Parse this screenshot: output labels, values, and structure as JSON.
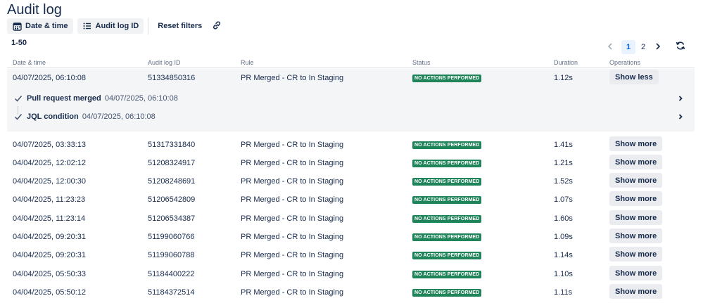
{
  "page": {
    "title": "Audit log"
  },
  "toolbar": {
    "date_time_label": "Date & time",
    "audit_id_label": "Audit log ID",
    "reset_label": "Reset filters"
  },
  "pagination": {
    "range": "1-50",
    "pages": [
      "1",
      "2"
    ],
    "current": "1"
  },
  "columns": [
    "Date & time",
    "Audit log ID",
    "Rule",
    "Status",
    "Duration",
    "Operations"
  ],
  "expanded_row": {
    "date": "04/07/2025, 06:10:08",
    "id": "51334850316",
    "rule": "PR Merged - CR to In Staging",
    "status": "NO ACTIONS PERFORMED",
    "duration": "1.12s",
    "action": "Show less",
    "steps": [
      {
        "name": "Pull request merged",
        "time": "04/07/2025, 06:10:08"
      },
      {
        "name": "JQL condition",
        "time": "04/07/2025, 06:10:08"
      }
    ]
  },
  "rows": [
    {
      "date": "04/07/2025, 03:33:13",
      "id": "51317331840",
      "rule": "PR Merged - CR to In Staging",
      "status": "NO ACTIONS PERFORMED",
      "duration": "1.41s",
      "action": "Show more"
    },
    {
      "date": "04/04/2025, 12:02:12",
      "id": "51208324917",
      "rule": "PR Merged - CR to In Staging",
      "status": "NO ACTIONS PERFORMED",
      "duration": "1.21s",
      "action": "Show more"
    },
    {
      "date": "04/04/2025, 12:00:30",
      "id": "51208248691",
      "rule": "PR Merged - CR to In Staging",
      "status": "NO ACTIONS PERFORMED",
      "duration": "1.52s",
      "action": "Show more"
    },
    {
      "date": "04/04/2025, 11:23:23",
      "id": "51206542809",
      "rule": "PR Merged - CR to In Staging",
      "status": "NO ACTIONS PERFORMED",
      "duration": "1.07s",
      "action": "Show more"
    },
    {
      "date": "04/04/2025, 11:23:14",
      "id": "51206534387",
      "rule": "PR Merged - CR to In Staging",
      "status": "NO ACTIONS PERFORMED",
      "duration": "1.60s",
      "action": "Show more"
    },
    {
      "date": "04/04/2025, 09:20:31",
      "id": "51199060766",
      "rule": "PR Merged - CR to In Staging",
      "status": "NO ACTIONS PERFORMED",
      "duration": "1.09s",
      "action": "Show more"
    },
    {
      "date": "04/04/2025, 09:20:31",
      "id": "51199060788",
      "rule": "PR Merged - CR to In Staging",
      "status": "NO ACTIONS PERFORMED",
      "duration": "1.14s",
      "action": "Show more"
    },
    {
      "date": "04/04/2025, 05:50:33",
      "id": "51184400222",
      "rule": "PR Merged - CR to In Staging",
      "status": "NO ACTIONS PERFORMED",
      "duration": "1.10s",
      "action": "Show more"
    },
    {
      "date": "04/04/2025, 05:50:12",
      "id": "51184372514",
      "rule": "PR Merged - CR to In Staging",
      "status": "NO ACTIONS PERFORMED",
      "duration": "1.11s",
      "action": "Show more"
    }
  ],
  "icons": {
    "date": "calendar-icon",
    "audit_id": "list-icon",
    "link": "link-icon",
    "prev": "chevron-left-icon",
    "next": "chevron-right-icon",
    "refresh": "refresh-icon",
    "step": "check-icon",
    "expand": "chevron-right-icon"
  },
  "colors": {
    "status_badge": "#1f845a",
    "active_page": "#0c66e4",
    "expanded_bg": "#f4f5f7"
  }
}
